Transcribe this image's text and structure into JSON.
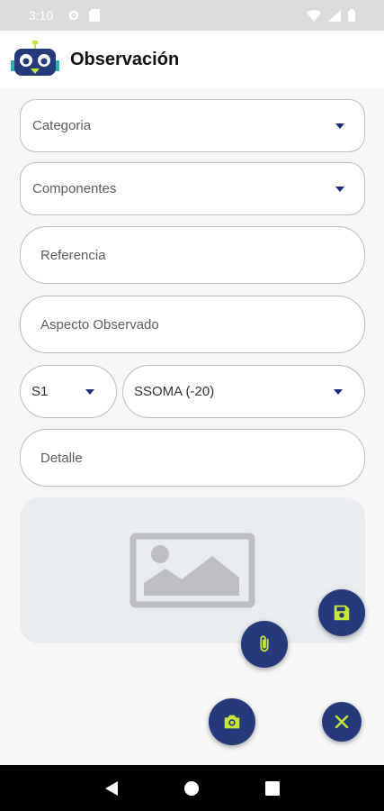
{
  "status_bar": {
    "time": "3:10"
  },
  "app_bar": {
    "title": "Observación"
  },
  "form": {
    "categoria": {
      "placeholder": "Categoria"
    },
    "componentes": {
      "placeholder": "Componentes"
    },
    "referencia": {
      "placeholder": "Referencia"
    },
    "aspecto": {
      "placeholder": "Aspecto Observado"
    },
    "severidad": {
      "value": "S1"
    },
    "tipo": {
      "value": "SSOMA (-20)"
    },
    "detalle": {
      "placeholder": "Detalle"
    }
  },
  "colors": {
    "fab_bg": "#243a7a",
    "fab_icon": "#c6e63a",
    "accent": "#1c2f7a"
  },
  "icons": {
    "save": "save-icon",
    "attach": "paperclip-icon",
    "camera": "camera-icon",
    "close": "close-icon",
    "image_placeholder": "image-placeholder-icon"
  }
}
